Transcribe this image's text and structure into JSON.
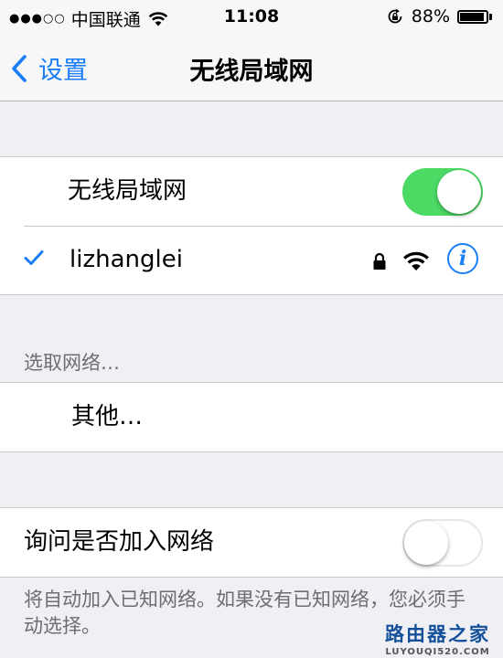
{
  "status_bar": {
    "signal": "●●●○○",
    "carrier": "中国联通",
    "time": "11:08",
    "battery": "88%",
    "battery_level": 0.88,
    "icons": [
      "signal-dots-icon",
      "wifi-icon",
      "rotation-lock-icon",
      "battery-icon"
    ]
  },
  "nav": {
    "back_label": "设置",
    "title": "无线局域网"
  },
  "wlan": {
    "toggle_label": "无线局域网",
    "toggle_on": true,
    "network_name": "lizhanglei",
    "info_glyph": "i",
    "icons": [
      "checkmark-icon",
      "lock-icon",
      "wifi-strength-icon",
      "info-icon"
    ]
  },
  "choose_network": {
    "header": "选取网络…",
    "other_label": "其他…"
  },
  "ask_join": {
    "label": "询问是否加入网络",
    "toggle_on": false,
    "footer": "将自动加入已知网络。如果没有已知网络，您必须手动选择。"
  },
  "watermark": {
    "title": "路由器之家",
    "url": "LUYOUQI520.COM"
  },
  "colors": {
    "accent": "#1a7ef7",
    "toggle_on": "#4cd964",
    "background": "#efeff4"
  }
}
